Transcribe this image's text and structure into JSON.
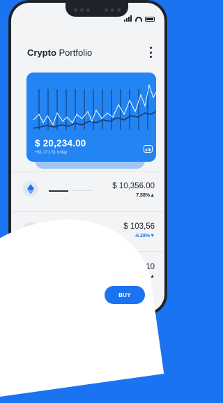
{
  "header": {
    "title_bold": "Crypto",
    "title_rest": "Portfolio"
  },
  "card": {
    "balance": "$ 20,234.00",
    "change": "+$1,271.51 today",
    "chart_icon": "bar-chart-icon"
  },
  "assets": [
    {
      "icon": "ethereum-icon",
      "price": "$ 10,356.00",
      "change": "7.58%▲",
      "trend": "up",
      "color": "#1e2329"
    },
    {
      "icon": "litecoin-icon",
      "price": "$ 103,56",
      "change": "-6.28%▼",
      "trend": "down",
      "color": "#1a73f0"
    },
    {
      "icon": "coin-icon",
      "price": "$ 15,356.10",
      "change": "7.58%▲",
      "trend": "up",
      "color": "#1e2329"
    }
  ],
  "buy_button": {
    "label": "BUY"
  },
  "colors": {
    "accent": "#1a73f0",
    "card": "#2384f3",
    "phone": "#1e2329"
  }
}
